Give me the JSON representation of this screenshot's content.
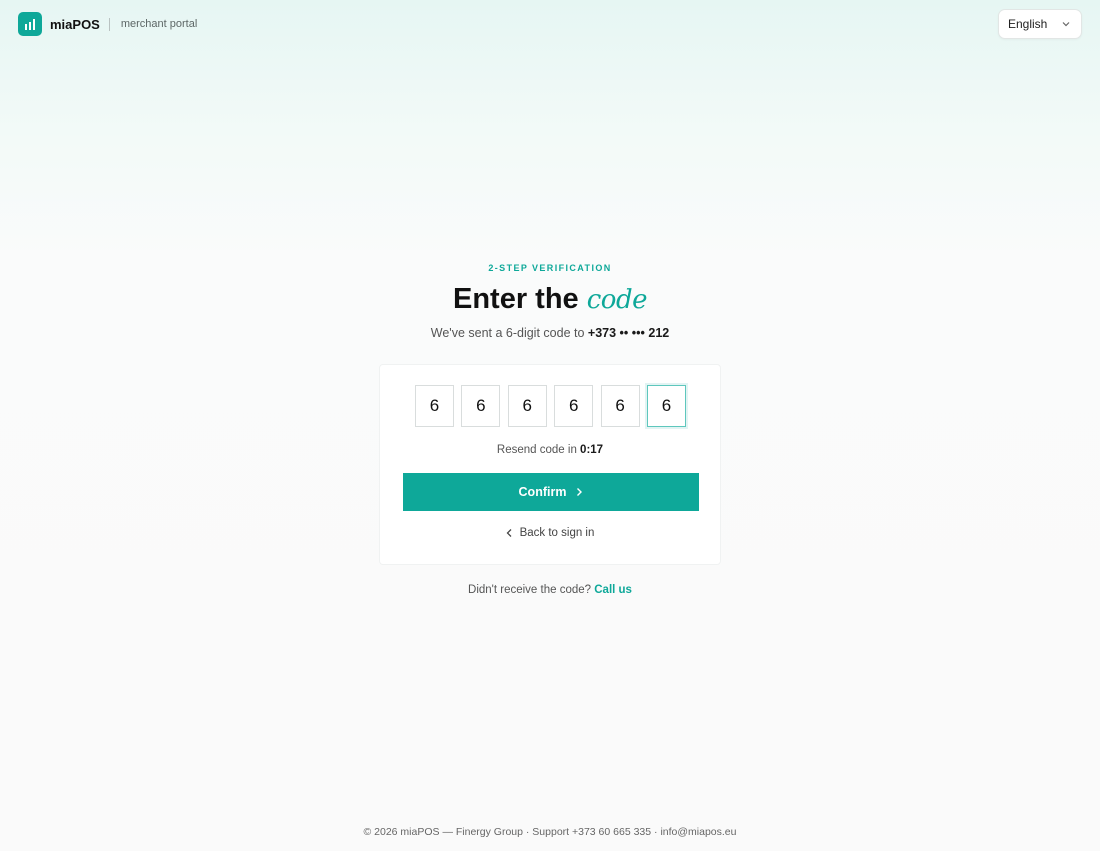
{
  "header": {
    "brand_name": "miaPOS",
    "brand_sub": "merchant portal",
    "language": "English"
  },
  "verify": {
    "eyebrow": "2-STEP VERIFICATION",
    "title_main": "Enter the",
    "title_accent": "code",
    "subtitle_prefix": "We've sent a 6-digit code to",
    "phone_masked": "+373 •• ••• 212",
    "digits": [
      "6",
      "6",
      "6",
      "6",
      "6",
      "6"
    ],
    "resend_prefix": "Resend code in",
    "resend_timer": "0:17",
    "confirm_label": "Confirm",
    "back_label": "Back to sign in"
  },
  "help": {
    "prompt": "Didn't receive the code?",
    "link": "Call us"
  },
  "footer": {
    "text": "© 2026 miaPOS — Finergy Group · Support +373 60 665 335 · info@miapos.eu"
  },
  "colors": {
    "accent": "#0ea899",
    "background_top": "#e6f6f3",
    "background": "#fafafa"
  },
  "icons": {
    "logo": "bar-chart-icon",
    "language": "chevron-down-icon",
    "confirm": "chevron-right-icon",
    "back": "chevron-left-icon"
  }
}
